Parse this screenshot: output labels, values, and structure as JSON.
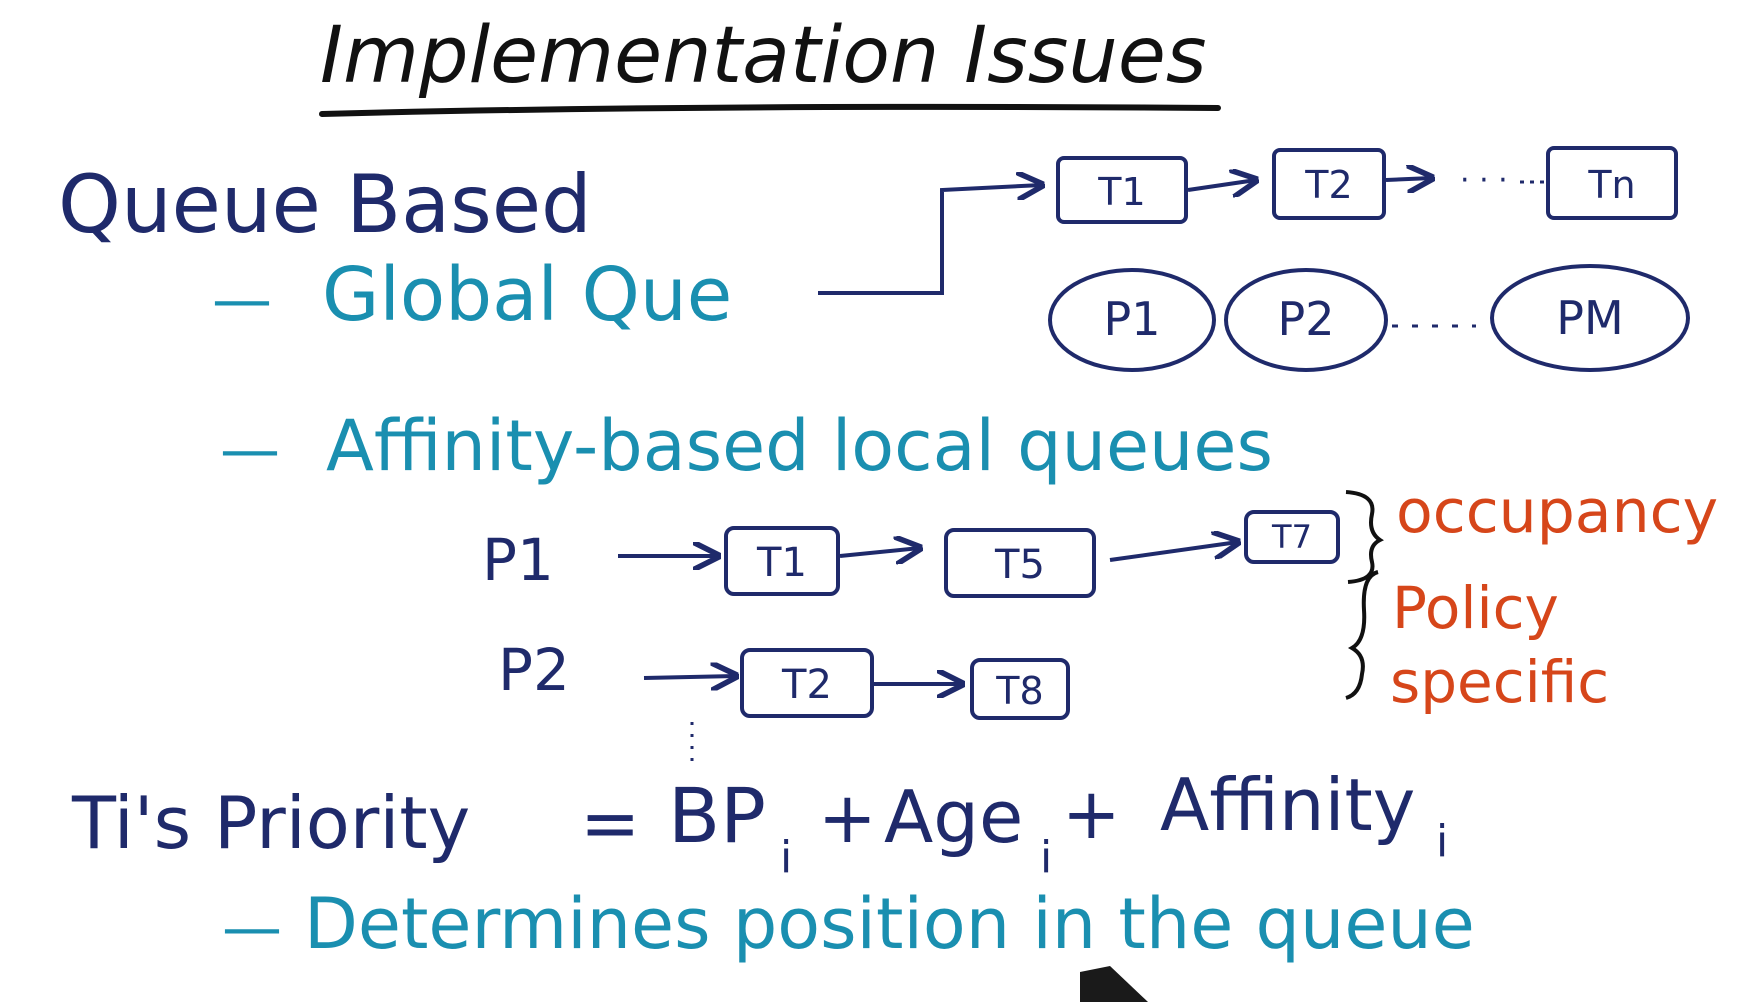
{
  "title": "Implementation Issues",
  "sections": {
    "queue_based": "Queue Based",
    "global_queue": "Global Que",
    "affinity_local": "Affinity-based local queues"
  },
  "global_queue": {
    "threads": [
      "T1",
      "T2",
      "Tn"
    ],
    "processors": [
      "P1",
      "P2",
      "PM"
    ],
    "ellipsis": "· · ·"
  },
  "local_queues": [
    {
      "processor": "P1",
      "threads": [
        "T1",
        "T5",
        "T7"
      ]
    },
    {
      "processor": "P2",
      "threads": [
        "T2",
        "T8"
      ]
    }
  ],
  "annotations": {
    "occupancy": "occupancy",
    "policy": "Policy",
    "specific": "specific"
  },
  "priority": {
    "label": "Ti's Priority",
    "equals": "=",
    "bp": "BP",
    "plus1": "+",
    "age": "Age",
    "plus2": "+",
    "affinity": "Affinity",
    "subscript": "i"
  },
  "determines": "Determines position in the queue",
  "dash": "—",
  "colors": {
    "navy": "#1f2a6b",
    "teal": "#1a8fb0",
    "orange": "#d6461a",
    "black": "#111111"
  }
}
